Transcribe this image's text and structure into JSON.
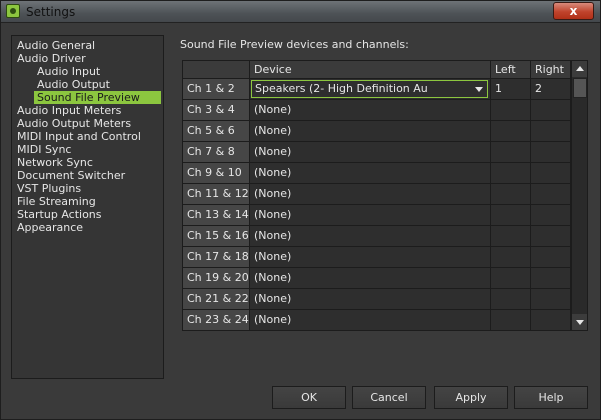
{
  "window": {
    "title": "Settings",
    "close_label": "x"
  },
  "nav": {
    "items": [
      {
        "label": "Audio General",
        "level": 0
      },
      {
        "label": "Audio Driver",
        "level": 0
      },
      {
        "label": "Audio Input",
        "level": 1
      },
      {
        "label": "Audio Output",
        "level": 1
      },
      {
        "label": "Sound File Preview",
        "level": 1,
        "selected": true
      },
      {
        "label": "Audio Input Meters",
        "level": 0
      },
      {
        "label": "Audio Output Meters",
        "level": 0
      },
      {
        "label": "MIDI Input and Control",
        "level": 0
      },
      {
        "label": "MIDI Sync",
        "level": 0
      },
      {
        "label": "Network Sync",
        "level": 0
      },
      {
        "label": "Document Switcher",
        "level": 0
      },
      {
        "label": "VST Plugins",
        "level": 0
      },
      {
        "label": "File Streaming",
        "level": 0
      },
      {
        "label": "Startup Actions",
        "level": 0
      },
      {
        "label": "Appearance",
        "level": 0
      }
    ]
  },
  "panel": {
    "title": "Sound File Preview devices and channels:"
  },
  "grid": {
    "headers": {
      "channel": "",
      "device": "Device",
      "left": "Left",
      "right": "Right"
    },
    "rows": [
      {
        "channel": "Ch 1 & 2",
        "device": "Speakers (2- High Definition Au",
        "left": "1",
        "right": "2",
        "active": true
      },
      {
        "channel": "Ch 3 & 4",
        "device": "(None)",
        "left": "",
        "right": ""
      },
      {
        "channel": "Ch 5 & 6",
        "device": "(None)",
        "left": "",
        "right": ""
      },
      {
        "channel": "Ch 7 & 8",
        "device": "(None)",
        "left": "",
        "right": ""
      },
      {
        "channel": "Ch 9 & 10",
        "device": "(None)",
        "left": "",
        "right": ""
      },
      {
        "channel": "Ch 11 & 12",
        "device": "(None)",
        "left": "",
        "right": ""
      },
      {
        "channel": "Ch 13 & 14",
        "device": "(None)",
        "left": "",
        "right": ""
      },
      {
        "channel": "Ch 15 & 16",
        "device": "(None)",
        "left": "",
        "right": ""
      },
      {
        "channel": "Ch 17 & 18",
        "device": "(None)",
        "left": "",
        "right": ""
      },
      {
        "channel": "Ch 19 & 20",
        "device": "(None)",
        "left": "",
        "right": ""
      },
      {
        "channel": "Ch 21 & 22",
        "device": "(None)",
        "left": "",
        "right": ""
      },
      {
        "channel": "Ch 23 & 24",
        "device": "(None)",
        "left": "",
        "right": ""
      }
    ]
  },
  "buttons": {
    "ok": "OK",
    "cancel": "Cancel",
    "apply": "Apply",
    "help": "Help"
  },
  "colors": {
    "accent": "#8cc63f"
  }
}
